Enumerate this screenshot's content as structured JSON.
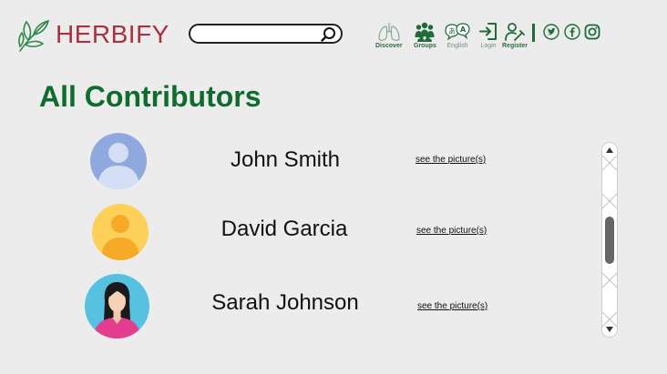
{
  "brand": {
    "name": "HERBIFY"
  },
  "search": {
    "value": "",
    "placeholder": ""
  },
  "nav": [
    {
      "label": "Discover",
      "icon": "lungs-icon"
    },
    {
      "label": "Groups",
      "icon": "group-icon"
    },
    {
      "label": "English",
      "icon": "language-icon"
    },
    {
      "label": "Login",
      "icon": "login-icon"
    },
    {
      "label": "Register",
      "icon": "register-icon"
    }
  ],
  "social": [
    "twitter-icon",
    "facebook-icon",
    "instagram-icon"
  ],
  "page": {
    "title": "All Contributors"
  },
  "contributors": [
    {
      "name": "John Smith",
      "link": "see the picture(s)",
      "avatar": "default-avatar-icon"
    },
    {
      "name": "David Garcia",
      "link": "see the picture(s)",
      "avatar": "yellow-user-avatar-icon"
    },
    {
      "name": "Sarah Johnson",
      "link": "see the picture(s)",
      "avatar": "woman-avatar-icon"
    }
  ],
  "colors": {
    "background": "#ececec",
    "title_green": "#0f6b2e",
    "brand_red": "#a8323f",
    "nav_green": "#2e6b3f"
  }
}
